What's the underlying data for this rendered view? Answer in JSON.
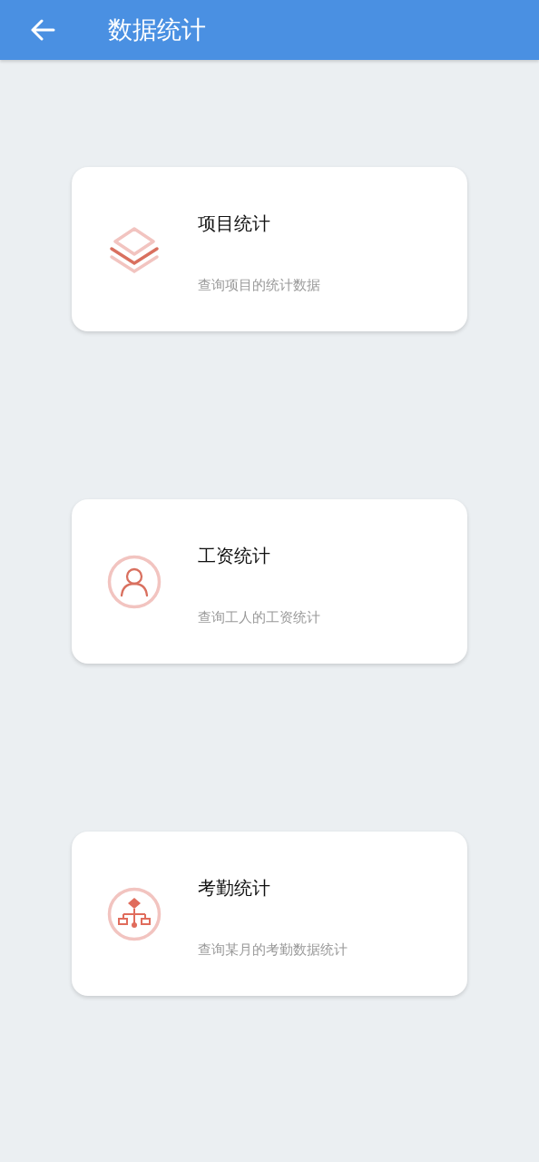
{
  "header": {
    "title": "数据统计"
  },
  "cards": [
    {
      "kind": "layers",
      "title": "项目统计",
      "subtitle": "查询项目的统计数据"
    },
    {
      "kind": "person",
      "title": "工资统计",
      "subtitle": "查询工人的工资统计"
    },
    {
      "kind": "hierarchy",
      "title": "考勤统计",
      "subtitle": "查询某月的考勤数据统计"
    }
  ]
}
